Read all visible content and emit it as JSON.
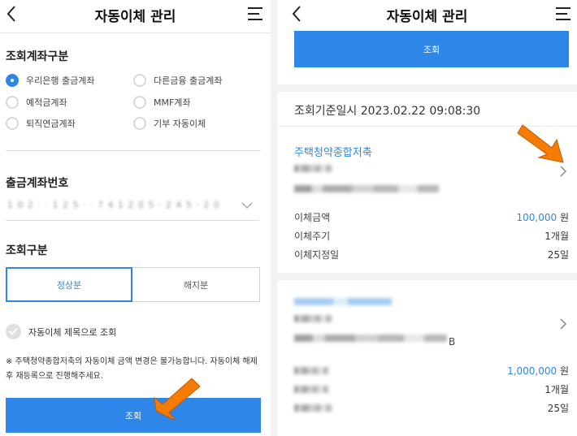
{
  "left_screen": {
    "header": {
      "title": "자동이체 관리"
    },
    "account_type": {
      "title": "조회계좌구분",
      "options": [
        {
          "label": "우리은행 출금계좌",
          "selected": true
        },
        {
          "label": "다른금융 출금계좌",
          "selected": false
        },
        {
          "label": "예적금계좌",
          "selected": false
        },
        {
          "label": "MMF계좌",
          "selected": false
        },
        {
          "label": "퇴직연금계좌",
          "selected": false
        },
        {
          "label": "기부 자동이체",
          "selected": false
        }
      ]
    },
    "withdraw_account": {
      "title": "출금계좌번호",
      "value_masked": "1 0 2 · · 1 2 5 · · 7 4 1 2 0 5 · 2 4 5 · 2 0"
    },
    "inquiry_type": {
      "title": "조회구분",
      "options": [
        {
          "label": "정상분",
          "active": true
        },
        {
          "label": "해지분",
          "active": false
        }
      ]
    },
    "title_check": {
      "label": "자동이체 제목으로 조회"
    },
    "notice": "※ 주택청약종합저축의 자동이체 금액 변경은 불가능합니다. 자동이체 해제 후 재등록으로 진행해주세요.",
    "search_button": "조회"
  },
  "right_screen": {
    "header": {
      "title": "자동이체 관리"
    },
    "search_button": "조회",
    "reference_time": "조회기준일시  2023.02.22 09:08:30",
    "cards": [
      {
        "title": "주택청약종합저축",
        "rows": [
          {
            "label": "이체금액",
            "amount": "100,000",
            "unit": " 원"
          },
          {
            "label": "이체주기",
            "value": "1개월"
          },
          {
            "label": "이체지정일",
            "value": "25일"
          }
        ]
      },
      {
        "suffix": "B",
        "rows": [
          {
            "amount": "1,000,000",
            "unit": " 원"
          },
          {
            "value": "1개월"
          },
          {
            "value": "25일"
          }
        ]
      }
    ]
  },
  "colors": {
    "accent": "#2f86e9",
    "pointer_arrow": "#f57c00"
  },
  "icons": {
    "back": "chevron-left-icon",
    "menu": "hamburger-menu-icon",
    "chevron": "chevron-right-icon",
    "pointer": "orange-pointer-arrow-icon"
  }
}
